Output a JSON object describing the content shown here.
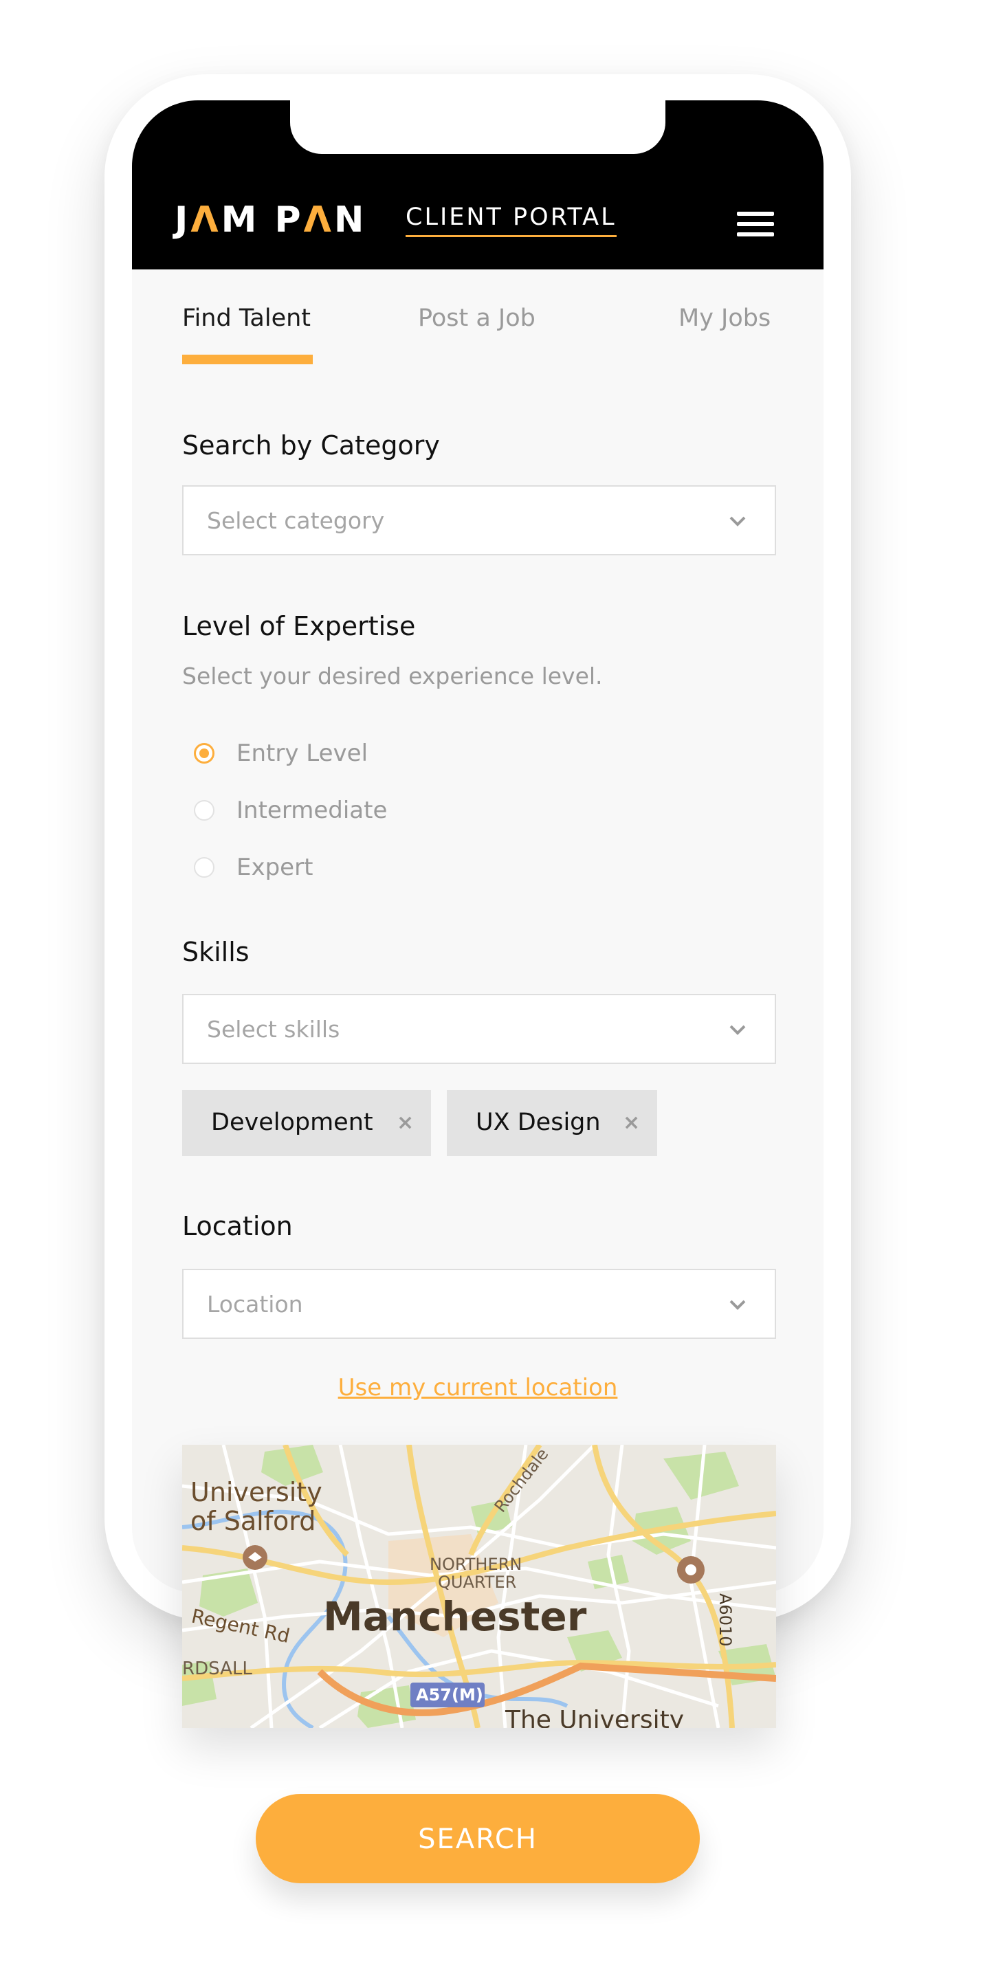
{
  "header": {
    "logo_left": "J",
    "logo_accent_1": "Λ",
    "logo_mid": "M P",
    "logo_accent_2": "Λ",
    "logo_end": "N",
    "portal_label": "CLIENT PORTAL"
  },
  "tabs": [
    {
      "label": "Find Talent",
      "active": true
    },
    {
      "label": "Post a Job",
      "active": false
    },
    {
      "label": "My Jobs",
      "active": false
    }
  ],
  "category": {
    "title": "Search by Category",
    "placeholder": "Select category"
  },
  "expertise": {
    "title": "Level of Expertise",
    "hint": "Select your desired experience level.",
    "options": [
      {
        "label": "Entry Level",
        "checked": true
      },
      {
        "label": "Intermediate",
        "checked": false
      },
      {
        "label": "Expert",
        "checked": false
      }
    ]
  },
  "skills": {
    "title": "Skills",
    "placeholder": "Select skills",
    "chips": [
      {
        "label": "Development",
        "remove": "×"
      },
      {
        "label": "UX Design",
        "remove": "×"
      }
    ]
  },
  "location": {
    "title": "Location",
    "placeholder": "Location",
    "use_current": "Use my current location"
  },
  "map": {
    "labels": {
      "university_salford_1": "University",
      "university_salford_2": "of Salford",
      "rochdale": "Rochdale",
      "northern_1": "NORTHERN",
      "northern_2": "QUARTER",
      "city": "Manchester",
      "regent": "Regent Rd",
      "ordsall": "RDSALL",
      "a6010": "A6010",
      "a57m": "A57(M)",
      "the_university": "The University"
    }
  },
  "search_button": "SEARCH",
  "colors": {
    "accent": "#fdae3d",
    "header_bg": "#000000",
    "screen_bg": "#f8f8f8"
  }
}
